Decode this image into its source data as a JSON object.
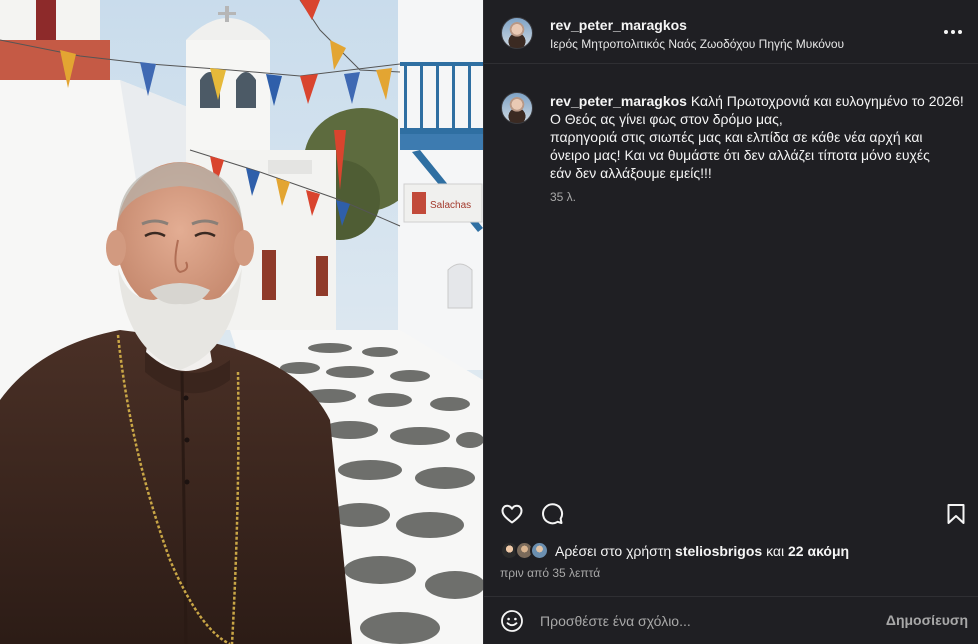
{
  "post": {
    "username": "rev_peter_maragkos",
    "location": "Ιερός Μητροπολιτικός Ναός Ζωοδόχου Πηγής Μυκόνου",
    "caption": {
      "author": "rev_peter_maragkos",
      "lines": [
        "Καλή Πρωτοχρονιά και ευλογημένο το 2026!",
        "Ο Θεός ας γίνει φως στον δρόμο μας,",
        "παρηγοριά στις σιωπές μας και ελπίδα σε κάθε νέα αρχή και",
        "όνειρο μας! Και να θυμάστε ότι δεν αλλάζει τίποτα μόνο ευχές",
        "εάν δεν αλλάξουμε εμείς!!!"
      ],
      "time": "35 λ."
    },
    "photo_sign": "Salachas"
  },
  "likes": {
    "prefix": "Αρέσει στο χρήστη",
    "user": "steliosbrigos",
    "conjunction": "και",
    "others": "22 ακόμη"
  },
  "post_time": "πριν από 35 λεπτά",
  "comment": {
    "placeholder": "Προσθέστε ένα σχόλιο...",
    "post_label": "Δημοσίευση"
  },
  "icons": {
    "more": "more-options-icon",
    "like": "heart-icon",
    "comment": "comment-bubble-icon",
    "save": "bookmark-icon",
    "emoji": "emoji-icon"
  },
  "colors": {
    "panel_bg": "#1f1f23",
    "text": "#f5f5f5",
    "muted": "#a8a8a8"
  }
}
